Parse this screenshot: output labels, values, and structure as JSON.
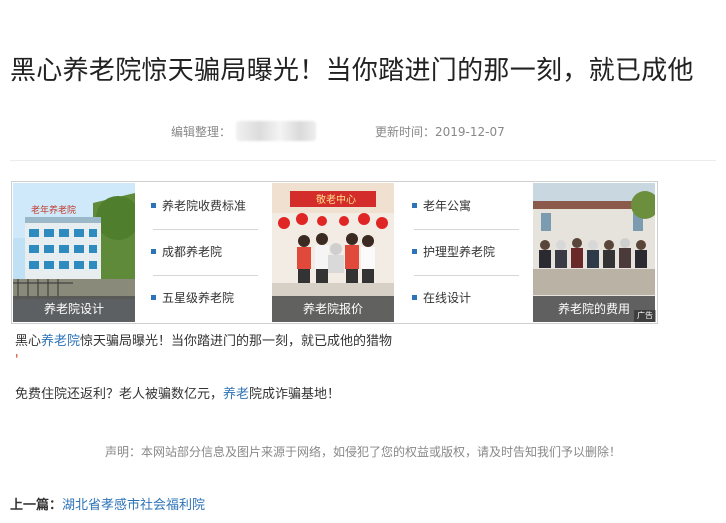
{
  "article": {
    "title": "黑心养老院惊天骗局曝光！当你踏进门的那一刻，就已成他",
    "editor_label": "编辑整理：",
    "update_label": "更新时间：",
    "update_date": "2019-12-07"
  },
  "ad": {
    "tag": "广告",
    "images": [
      {
        "caption": "养老院设计",
        "sign": "老年养老院"
      },
      {
        "caption": "养老院报价",
        "banner": "敬老中心"
      },
      {
        "caption": "养老院的费用"
      }
    ],
    "lists": [
      [
        "养老院收费标准",
        "成都养老院",
        "五星级养老院"
      ],
      [
        "老年公寓",
        "护理型养老院",
        "在线设计"
      ]
    ]
  },
  "body": {
    "para1_a": "黑心",
    "para1_kw": "养老院",
    "para1_b": "惊天骗局曝光！当你踏进门的那一刻，就已成他的猎物",
    "para2_mark": "'",
    "para3_a": "免费住院还返利？老人被骗数亿元，",
    "para3_kw": "养老",
    "para3_b": "院成诈骗基地！",
    "declare": "声明：本网站部分信息及图片来源于网络，如侵犯了您的权益或版权，请及时告知我们予以删除！"
  },
  "nav": {
    "prev_label": "上一篇：",
    "prev_link": "湖北省孝感市社会福利院"
  },
  "colors": {
    "accent": "#2d73b8",
    "caption_bg": "#555555"
  }
}
